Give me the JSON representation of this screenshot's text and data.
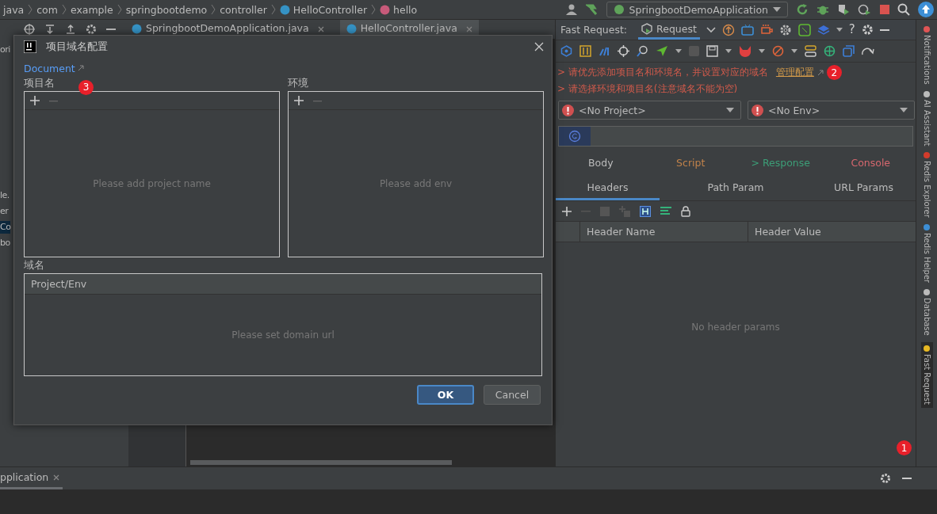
{
  "breadcrumbs": [
    {
      "label": "java",
      "kind": "plain"
    },
    {
      "label": "com",
      "kind": "plain"
    },
    {
      "label": "example",
      "kind": "plain"
    },
    {
      "label": "springbootdemo",
      "kind": "plain"
    },
    {
      "label": "controller",
      "kind": "plain"
    },
    {
      "label": "HelloController",
      "kind": "class"
    },
    {
      "label": "hello",
      "kind": "method"
    }
  ],
  "run_config": {
    "label": "SpringbootDemoApplication"
  },
  "editor_tabs": [
    {
      "label": "SpringbootDemoApplication.java",
      "selected": false
    },
    {
      "label": "HelloController.java",
      "selected": true
    }
  ],
  "project_tree": [
    {
      "label": "ori",
      "selected": false
    },
    {
      "label": "le.",
      "selected": false
    },
    {
      "label": "er",
      "selected": false
    },
    {
      "label": "Co",
      "selected": true
    },
    {
      "label": "bo",
      "selected": false
    }
  ],
  "dialog": {
    "title": "项目域名配置",
    "doc_link": "Document",
    "badge": "3",
    "project_label": "项目名",
    "env_label": "环境",
    "project_placeholder": "Please add project name",
    "env_placeholder": "Please add env",
    "domain_label": "域名",
    "domain_column": "Project/Env",
    "domain_placeholder": "Please set domain url",
    "buttons": [
      {
        "label": "OK",
        "default": true
      },
      {
        "label": "Cancel",
        "default": false
      }
    ]
  },
  "fast_request": {
    "title": "Fast Request:",
    "tab": {
      "label": "Request",
      "selected": true
    },
    "messages": [
      {
        "text": "> 请优先添加项目名和环境名，并设置对应的域名",
        "link": "管理配置",
        "badge": "2"
      },
      {
        "text": "> 请选择环境和项目名(注意域名不能为空)"
      }
    ],
    "project_select": "<No Project>",
    "env_select": "<No Env>",
    "section_tabs": [
      {
        "label": "Body",
        "color": "#bbbbbb"
      },
      {
        "label": "Script",
        "color": "#c0824a"
      },
      {
        "label": "> Response",
        "color": "#3c9e77"
      },
      {
        "label": "Console",
        "color": "#d6676e"
      }
    ],
    "param_tabs": [
      {
        "label": "Headers",
        "selected": true
      },
      {
        "label": "Path Param",
        "selected": false
      },
      {
        "label": "URL Params",
        "selected": false
      }
    ],
    "columns": [
      "Header Name",
      "Header Value"
    ],
    "empty": "No header params",
    "badge": "1",
    "help": "?"
  },
  "side_tools": [
    {
      "label": "Notifications",
      "kind": "bell"
    },
    {
      "label": "AI Assistant",
      "kind": "at"
    },
    {
      "label": "Redis Explorer",
      "kind": "redis"
    },
    {
      "label": "Redis Helper",
      "kind": "stack"
    },
    {
      "label": "Database",
      "kind": "db"
    },
    {
      "label": "Fast Request",
      "kind": "bolt"
    }
  ],
  "bottom_panel": {
    "tab": "pplication"
  }
}
